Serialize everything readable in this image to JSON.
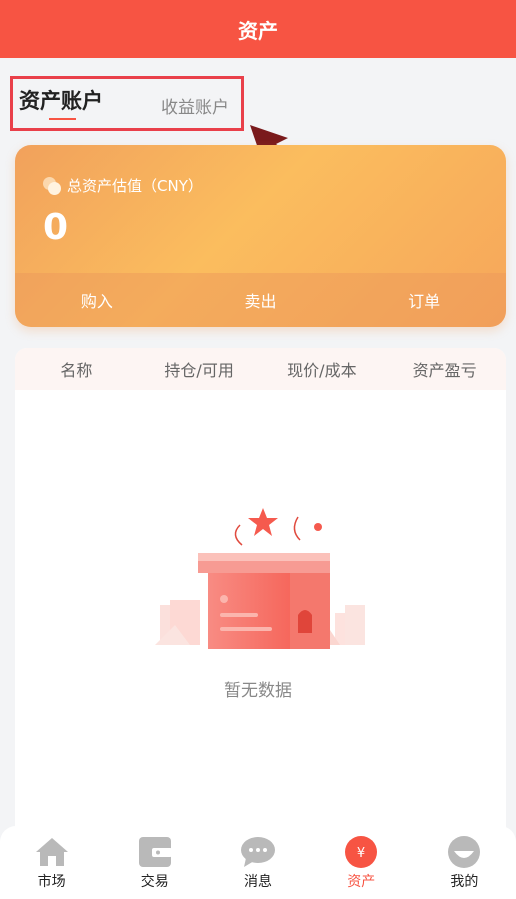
{
  "header": {
    "title": "资产"
  },
  "tabs": {
    "active": "资产账户",
    "inactive": "收益账户"
  },
  "card": {
    "label": "总资产估值（CNY）",
    "value": "0",
    "actions": [
      "购入",
      "卖出",
      "订单"
    ]
  },
  "table": {
    "columns": [
      "名称",
      "持仓/可用",
      "现价/成本",
      "资产盈亏"
    ],
    "empty_text": "暂无数据"
  },
  "tabbar": [
    {
      "label": "市场",
      "icon": "home-icon"
    },
    {
      "label": "交易",
      "icon": "wallet-icon"
    },
    {
      "label": "消息",
      "icon": "chat-icon"
    },
    {
      "label": "资产",
      "icon": "yen-icon",
      "active": true
    },
    {
      "label": "我的",
      "icon": "avatar-icon"
    }
  ],
  "colors": {
    "accent": "#f75443",
    "card_start": "#f1a15c",
    "card_end": "#fbbd5e"
  }
}
